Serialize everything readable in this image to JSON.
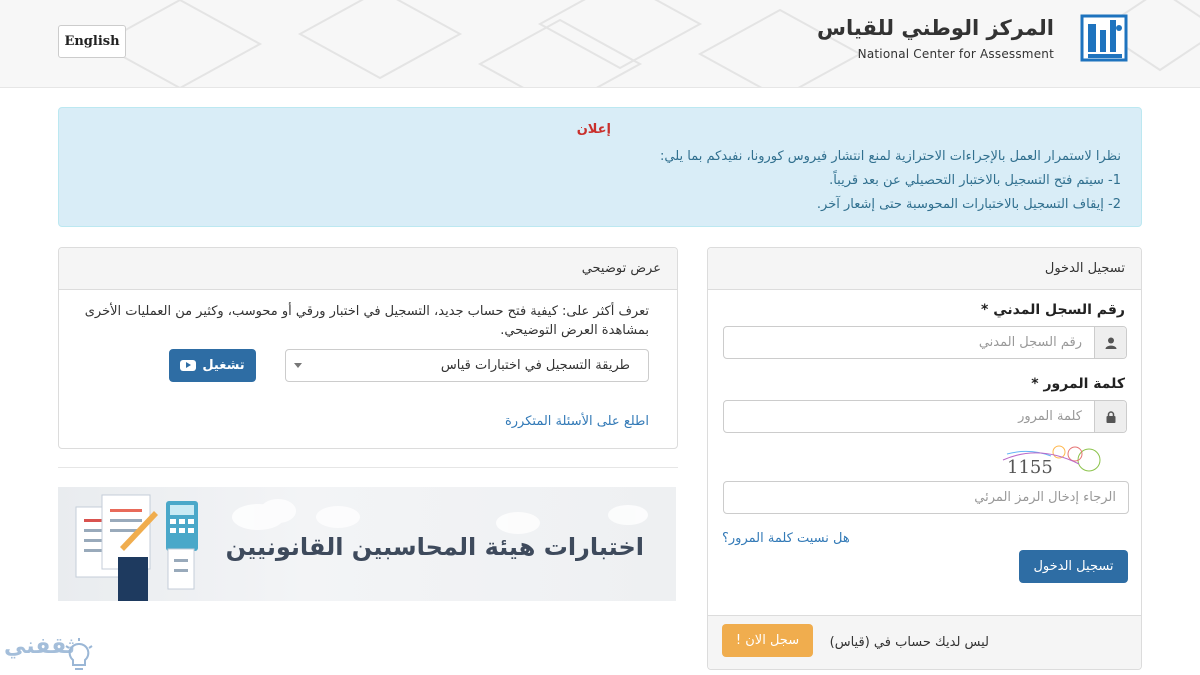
{
  "header": {
    "language_button": "English",
    "brand_arabic": "المركز الوطني للقياس",
    "brand_english": "National Center for Assessment",
    "logo_text": "قياس"
  },
  "announcement": {
    "title": "إعلان",
    "intro": "نظرا لاستمرار العمل بالإجراءات الاحترازية لمنع انتشار فيروس كورونا، نفيدكم بما يلي:",
    "items": [
      "1-  سيتم فتح التسجيل بالاختبار التحصيلي عن بعد قريباً.",
      "2- إيقاف التسجيل بالاختبارات المحوسبة حتى إشعار آخر."
    ]
  },
  "demo": {
    "heading": "عرض توضيحي",
    "description": "تعرف أكثر على: كيفية فتح حساب جديد، التسجيل في اختبار ورقي أو محوسب، وكثير من العمليات الأخرى بمشاهدة العرض التوضيحي.",
    "select_value": "طريقة التسجيل في اختبارات قياس",
    "play_label": "تشغيل",
    "faq_link": "اطلع على الأسئلة المتكررة"
  },
  "banner": {
    "text": "اختبارات هيئة المحاسبين القانونيين"
  },
  "login": {
    "heading": "تسجيل الدخول",
    "id_label": "رقم السجل المدني *",
    "id_placeholder": "رقم السجل المدني",
    "password_label": "كلمة المرور *",
    "password_placeholder": "كلمة المرور",
    "captcha_code": "1155",
    "captcha_placeholder": "الرجاء إدخال الرمز المرئي",
    "forgot_link": "هل نسيت كلمة المرور؟",
    "submit_label": "تسجيل الدخول",
    "no_account_text": "ليس لديك حساب في (قياس)",
    "register_label": "سجل الان !"
  },
  "watermark": {
    "text": "ثقفني"
  },
  "colors": {
    "primary": "#2e6da4",
    "warning": "#f0ad4e",
    "alert_bg": "#d9edf7",
    "alert_title": "#c9302c",
    "link": "#337ab7"
  }
}
